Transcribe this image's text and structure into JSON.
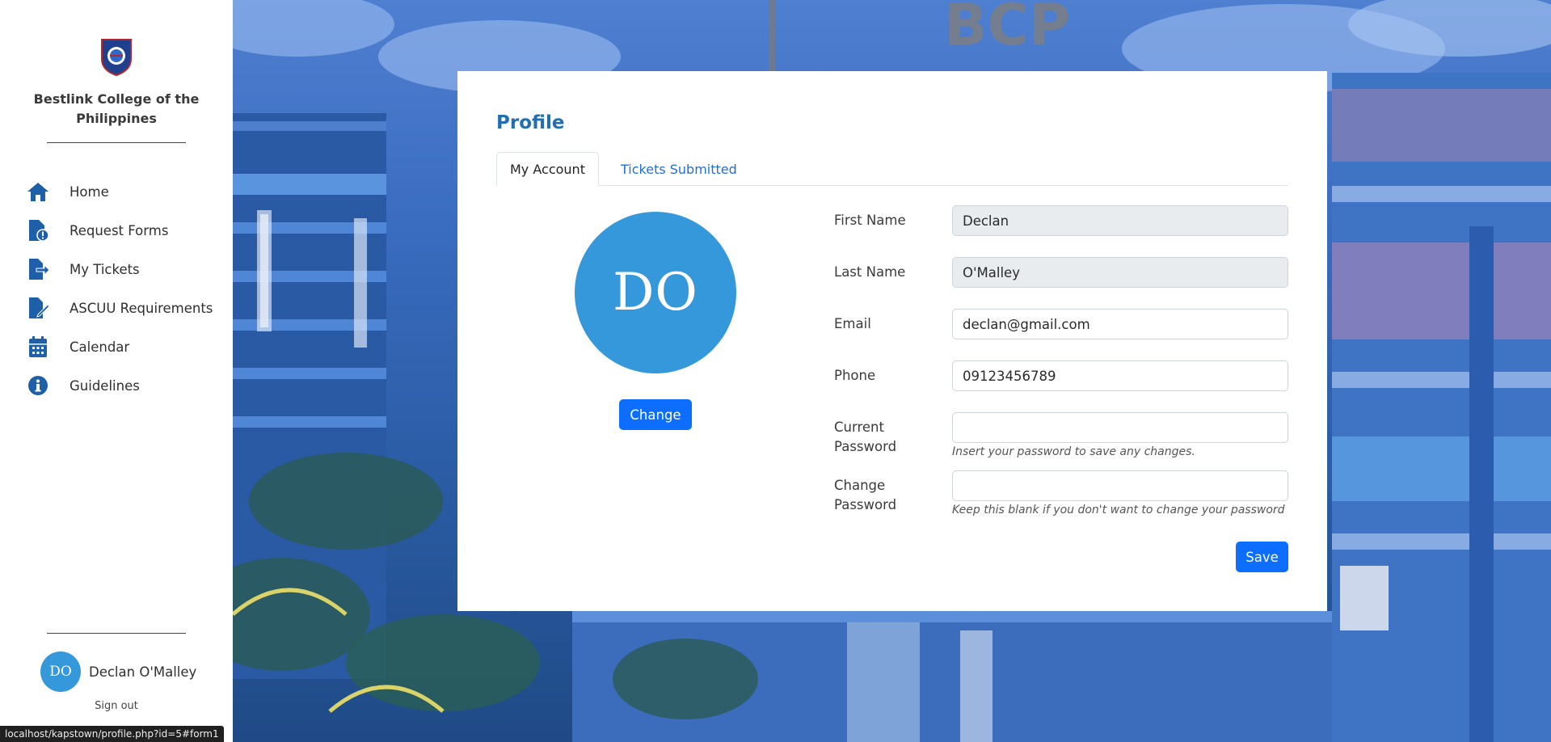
{
  "sidebar": {
    "college_name_line1": "Bestlink College of the",
    "college_name_line2": "Philippines",
    "items": [
      {
        "label": "Home",
        "icon": "home-icon"
      },
      {
        "label": "Request Forms",
        "icon": "file-alert-icon"
      },
      {
        "label": "My Tickets",
        "icon": "file-export-icon"
      },
      {
        "label": "ASCUU Requirements",
        "icon": "file-signature-icon"
      },
      {
        "label": "Calendar",
        "icon": "calendar-icon"
      },
      {
        "label": "Guidelines",
        "icon": "info-icon"
      }
    ],
    "user": {
      "initials": "DO",
      "name": "Declan O'Malley"
    },
    "signout_label": "Sign out"
  },
  "colors": {
    "accent": "#0d6efd",
    "avatar": "#3498db",
    "nav_icon": "#1f5fa8",
    "title": "#1f6fb2"
  },
  "profile": {
    "title": "Profile",
    "tabs": [
      {
        "label": "My Account",
        "active": true
      },
      {
        "label": "Tickets Submitted",
        "active": false
      }
    ],
    "avatar_initials": "DO",
    "change_label": "Change",
    "fields": {
      "first_name": {
        "label": "First Name",
        "value": "Declan"
      },
      "last_name": {
        "label": "Last Name",
        "value": "O'Malley"
      },
      "email": {
        "label": "Email",
        "value": "declan@gmail.com"
      },
      "phone": {
        "label": "Phone",
        "value": "09123456789"
      },
      "current_password": {
        "label_line1": "Current",
        "label_line2": "Password",
        "value": "",
        "help": "Insert your password to save any changes."
      },
      "change_password": {
        "label_line1": "Change",
        "label_line2": "Password",
        "value": "",
        "help": "Keep this blank if you don't want to change your password"
      }
    },
    "save_label": "Save"
  },
  "statusbar": {
    "url": "localhost/kapstown/profile.php?id=5#form1"
  }
}
